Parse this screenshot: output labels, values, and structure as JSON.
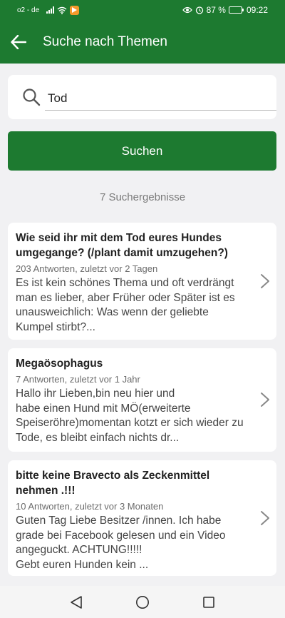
{
  "status_bar": {
    "carrier": "o2 - de",
    "battery_percent": "87 %",
    "battery_level": 0.87,
    "time": "09:22"
  },
  "appbar": {
    "title": "Suche nach Themen",
    "back_icon": "arrow-back-icon"
  },
  "search": {
    "value": "Tod",
    "icon": "search-icon",
    "button_label": "Suchen"
  },
  "results": {
    "count_label": "7 Suchergebnisse",
    "items": [
      {
        "title": "Wie seid ihr mit dem Tod eures Hundes umgegange? (/plant damit umzugehen?)",
        "meta": "203 Antworten, zuletzt vor 2 Tagen",
        "snippet": "Es ist kein schönes Thema und oft verdrängt man es lieber, aber Früher oder Später ist es unausweichlich: Was wenn der geliebte Kumpel stirbt?..."
      },
      {
        "title": "Megaösophagus",
        "meta": "7 Antworten, zuletzt vor 1 Jahr",
        "snippet": "Hallo ihr Lieben,bin neu hier und\nhabe einen Hund mit MÖ(erweiterte Speiseröhre)momentan kotzt er sich wieder zu Tode, es bleibt einfach nichts dr..."
      },
      {
        "title": "bitte keine Bravecto als Zeckenmittel nehmen .!!!",
        "meta": "10 Antworten, zuletzt vor 3 Monaten",
        "snippet": "Guten Tag Liebe Besitzer /innen. Ich habe grade bei Facebook gelesen und ein Video angeguckt.     ACHTUNG!!!!!\n                Gebt euren Hunden kein                  ..."
      }
    ]
  },
  "navbar": {
    "back": "triangle-back-icon",
    "home": "circle-home-icon",
    "recents": "square-recents-icon"
  },
  "colors": {
    "primary": "#1d7a30",
    "background": "#f1f1f3"
  }
}
